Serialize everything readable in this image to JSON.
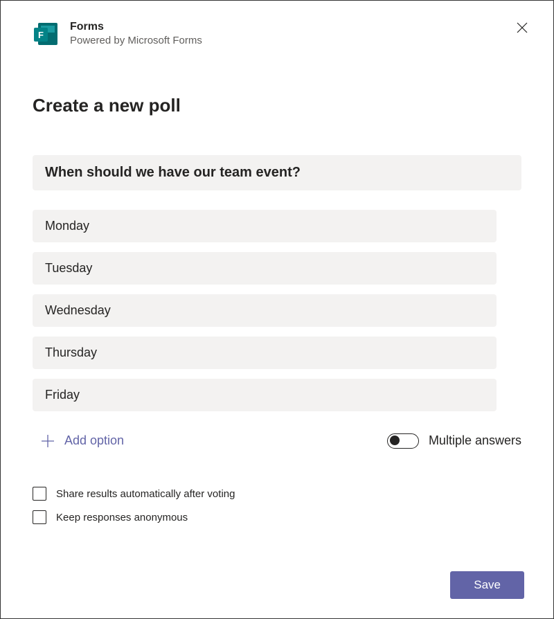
{
  "header": {
    "title": "Forms",
    "subtitle": "Powered by Microsoft Forms"
  },
  "page_title": "Create a new poll",
  "question": "When should we have our team event?",
  "options": [
    "Monday",
    "Tuesday",
    "Wednesday",
    "Thursday",
    "Friday"
  ],
  "add_option_label": "Add option",
  "multiple_answers_label": "Multiple answers",
  "checkboxes": {
    "share_results": "Share results automatically after voting",
    "anonymous": "Keep responses anonymous"
  },
  "save_label": "Save"
}
